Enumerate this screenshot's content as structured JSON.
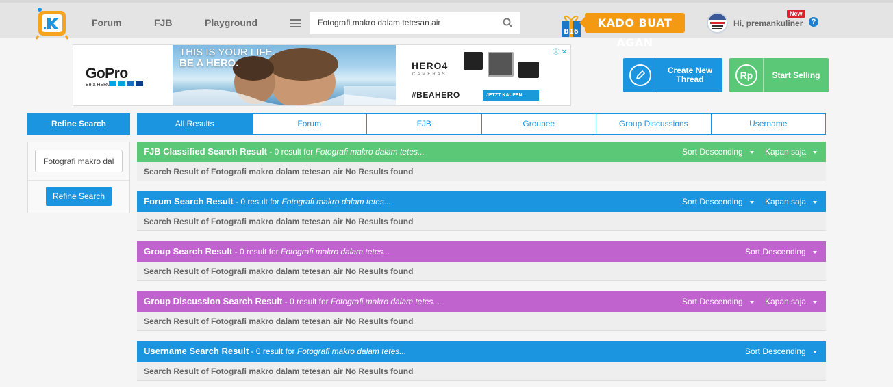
{
  "header": {
    "nav": [
      "Forum",
      "FJB",
      "Playground"
    ],
    "search_value": "Fotografi makro dalam tetesan air",
    "promo_label": "KADO BUAT AGAN",
    "promo_badge": "B16",
    "username": "Hi, premankuliner",
    "new_badge": "New",
    "help": "?"
  },
  "ad": {
    "brand": "GoPro",
    "brand_tag": "Be a HERO.",
    "headline_1": "THIS IS YOUR LIFE.",
    "headline_2": "BE A HERO.",
    "product": "HERO4",
    "product_sub": "CAMERAS",
    "hashtag": "#BEAHERO",
    "cta": "JETZT KAUFEN"
  },
  "actions": {
    "create_thread": "Create New Thread",
    "start_selling": "Start Selling",
    "sell_icon": "Rp"
  },
  "sidebar": {
    "title": "Refine Search",
    "input_value": "Fotografi makro dalam tetesan air",
    "button": "Refine Search"
  },
  "tabs": [
    "All Results",
    "Forum",
    "FJB",
    "Groupee",
    "Group Discussions",
    "Username"
  ],
  "sections": [
    {
      "title": "FJB Classified Search Result",
      "result_text": " - 0 result for ",
      "query": "Fotografi makro dalam tetes...",
      "sort": "Sort Descending",
      "time": "Kapan saja",
      "body": "Search Result of Fotografi makro dalam tetesan air No Results found",
      "color": "#5bc877"
    },
    {
      "title": "Forum Search Result",
      "result_text": " - 0 result for ",
      "query": "Fotografi makro dalam tetes...",
      "sort": "Sort Descending",
      "time": "Kapan saja",
      "body": "Search Result of Fotografi makro dalam tetesan air No Results found",
      "color": "#1b95e0"
    },
    {
      "title": "Group Search Result",
      "result_text": " - 0 result for ",
      "query": "Fotografi makro dalam tetes...",
      "sort": "Sort Descending",
      "body": "Search Result of Fotografi makro dalam tetesan air No Results found",
      "color": "#c163cf"
    },
    {
      "title": "Group Discussion Search Result",
      "result_text": " - 0 result for ",
      "query": "Fotografi makro dalam tetes...",
      "sort": "Sort Descending",
      "time": "Kapan saja",
      "body": "Search Result of Fotografi makro dalam tetesan air No Results found",
      "color": "#c163cf"
    },
    {
      "title": "Username Search Result",
      "result_text": " - 0 result for ",
      "query": "Fotografi makro dalam tetes...",
      "sort": "Sort Descending",
      "body": "Search Result of Fotografi makro dalam tetesan air No Results found",
      "color": "#1b95e0"
    }
  ]
}
